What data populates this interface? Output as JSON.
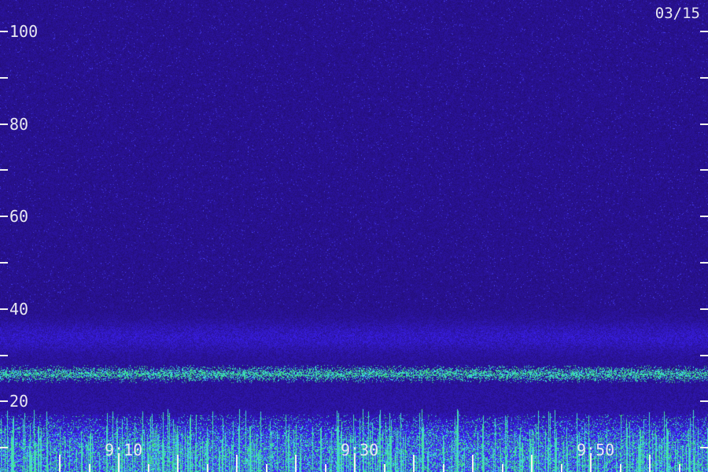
{
  "chart_data": {
    "type": "heatmap",
    "title": "",
    "date_label": "03/15",
    "xlabel": "",
    "ylabel": "",
    "y_tick_labels": [
      "100",
      "80",
      "60",
      "40",
      "20"
    ],
    "x_tick_labels": [
      "9:10",
      "9:30",
      "9:50"
    ],
    "ylim": [
      0,
      110
    ],
    "minor_y_ticks": [
      10,
      30,
      50,
      70,
      90
    ],
    "major_y_ticks": [
      20,
      40,
      60,
      80,
      100
    ],
    "x_ticks_minor_count": 24,
    "bands": [
      {
        "center": 26,
        "width": 1.2,
        "intensity": 0.85,
        "color": "green"
      },
      {
        "center": 34,
        "width": 3,
        "intensity": 0.55,
        "color": "blue"
      },
      {
        "center": 8,
        "width": 10,
        "intensity": 0.95,
        "color": "mixed"
      }
    ],
    "colors": {
      "background": "#24106a",
      "noise_high": "#3a2bd0",
      "band_green": "#34d08a",
      "band_cyan": "#3ce6e0",
      "axis": "#f0f0f0"
    }
  }
}
